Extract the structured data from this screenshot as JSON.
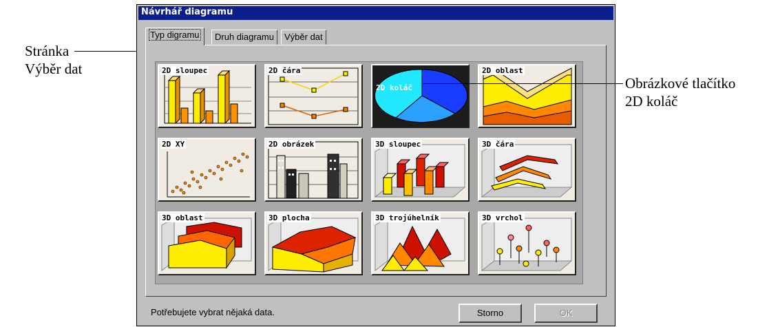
{
  "window": {
    "title": "Návrhář diagramu"
  },
  "tabs": [
    {
      "label": "Typ digramu",
      "active": true
    },
    {
      "label": "Druh diagramu",
      "active": false
    },
    {
      "label": "Výběr dat",
      "active": false
    }
  ],
  "chart_buttons": [
    {
      "label": "2D sloupec"
    },
    {
      "label": "2D čára"
    },
    {
      "label": "2D koláč",
      "selected": true
    },
    {
      "label": "2D oblast"
    },
    {
      "label": "2D XY"
    },
    {
      "label": "2D obrázek"
    },
    {
      "label": "3D sloupec"
    },
    {
      "label": "3D čára"
    },
    {
      "label": "3D oblast"
    },
    {
      "label": "3D plocha"
    },
    {
      "label": "3D trojúhelník"
    },
    {
      "label": "3D vrchol"
    }
  ],
  "status_text": "Potřebujete vybrat nějaká data.",
  "buttons": {
    "cancel": "Storno",
    "ok": "OK"
  },
  "annotations": {
    "left_line1": "Stránka",
    "left_line2": "Výběr dat",
    "right_line1": "Obrázkové tlačítko",
    "right_line2": "2D koláč"
  },
  "colors": {
    "title_bar": "#0a1f8a",
    "dialog_bg": "#c0c0c0",
    "accent_yellow": "#ffff00",
    "accent_red": "#cc2200"
  }
}
